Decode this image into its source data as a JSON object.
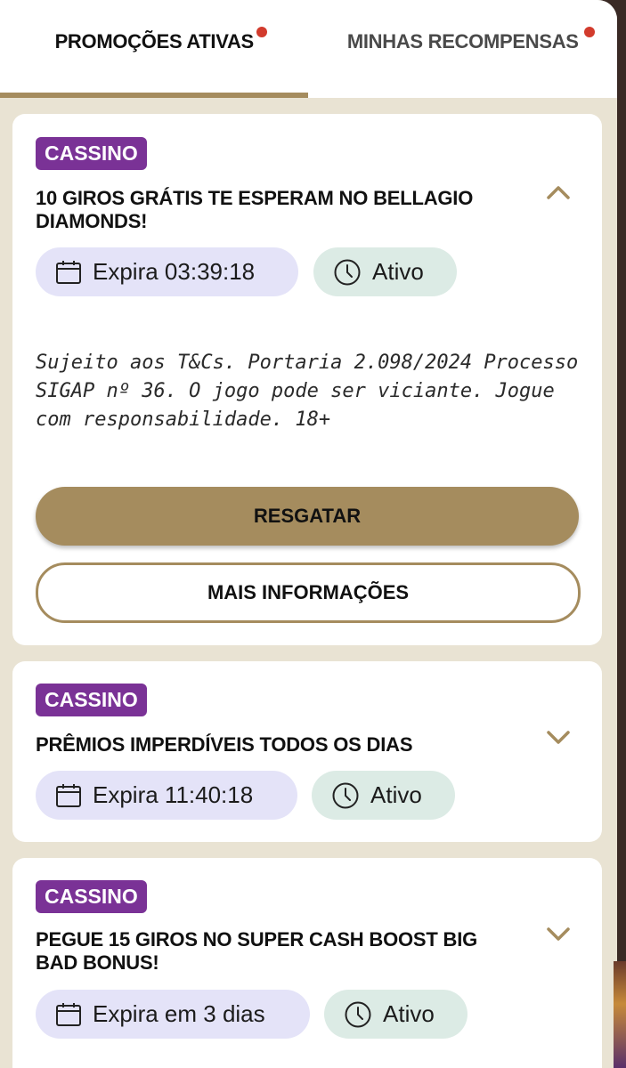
{
  "tabs": [
    {
      "label": "PROMOÇÕES ATIVAS",
      "active": true,
      "has_notification": true
    },
    {
      "label": "MINHAS RECOMPENSAS",
      "active": false,
      "has_notification": true
    }
  ],
  "colors": {
    "accent_gold": "#a58c5e",
    "badge_purple": "#7a3296",
    "notification_red": "#d23b2d",
    "expire_pill": "#e4e3f8",
    "status_pill": "#dcebe5"
  },
  "promotions": [
    {
      "category": "CASSINO",
      "title": "10 GIROS GRÁTIS TE ESPERAM NO BELLAGIO DIAMONDS!",
      "expiry": "Expira 03:39:18",
      "status": "Ativo",
      "expanded": true,
      "toggle_icon": "chevron-up-icon",
      "terms": "Sujeito aos T&Cs. Portaria 2.098/2024 Processo SIGAP nº 36. O jogo pode ser viciante. Jogue com responsabilidade. 18+",
      "primary_button": "RESGATAR",
      "secondary_button": "MAIS INFORMAÇÕES"
    },
    {
      "category": "CASSINO",
      "title": "PRÊMIOS IMPERDÍVEIS TODOS OS DIAS",
      "expiry": "Expira 11:40:18",
      "status": "Ativo",
      "expanded": false,
      "toggle_icon": "chevron-down-icon"
    },
    {
      "category": "CASSINO",
      "title": "PEGUE 15 GIROS NO SUPER CASH BOOST BIG BAD BONUS!",
      "expiry": "Expira em 3 dias",
      "status": "Ativo",
      "expanded": false,
      "toggle_icon": "chevron-down-icon"
    }
  ]
}
